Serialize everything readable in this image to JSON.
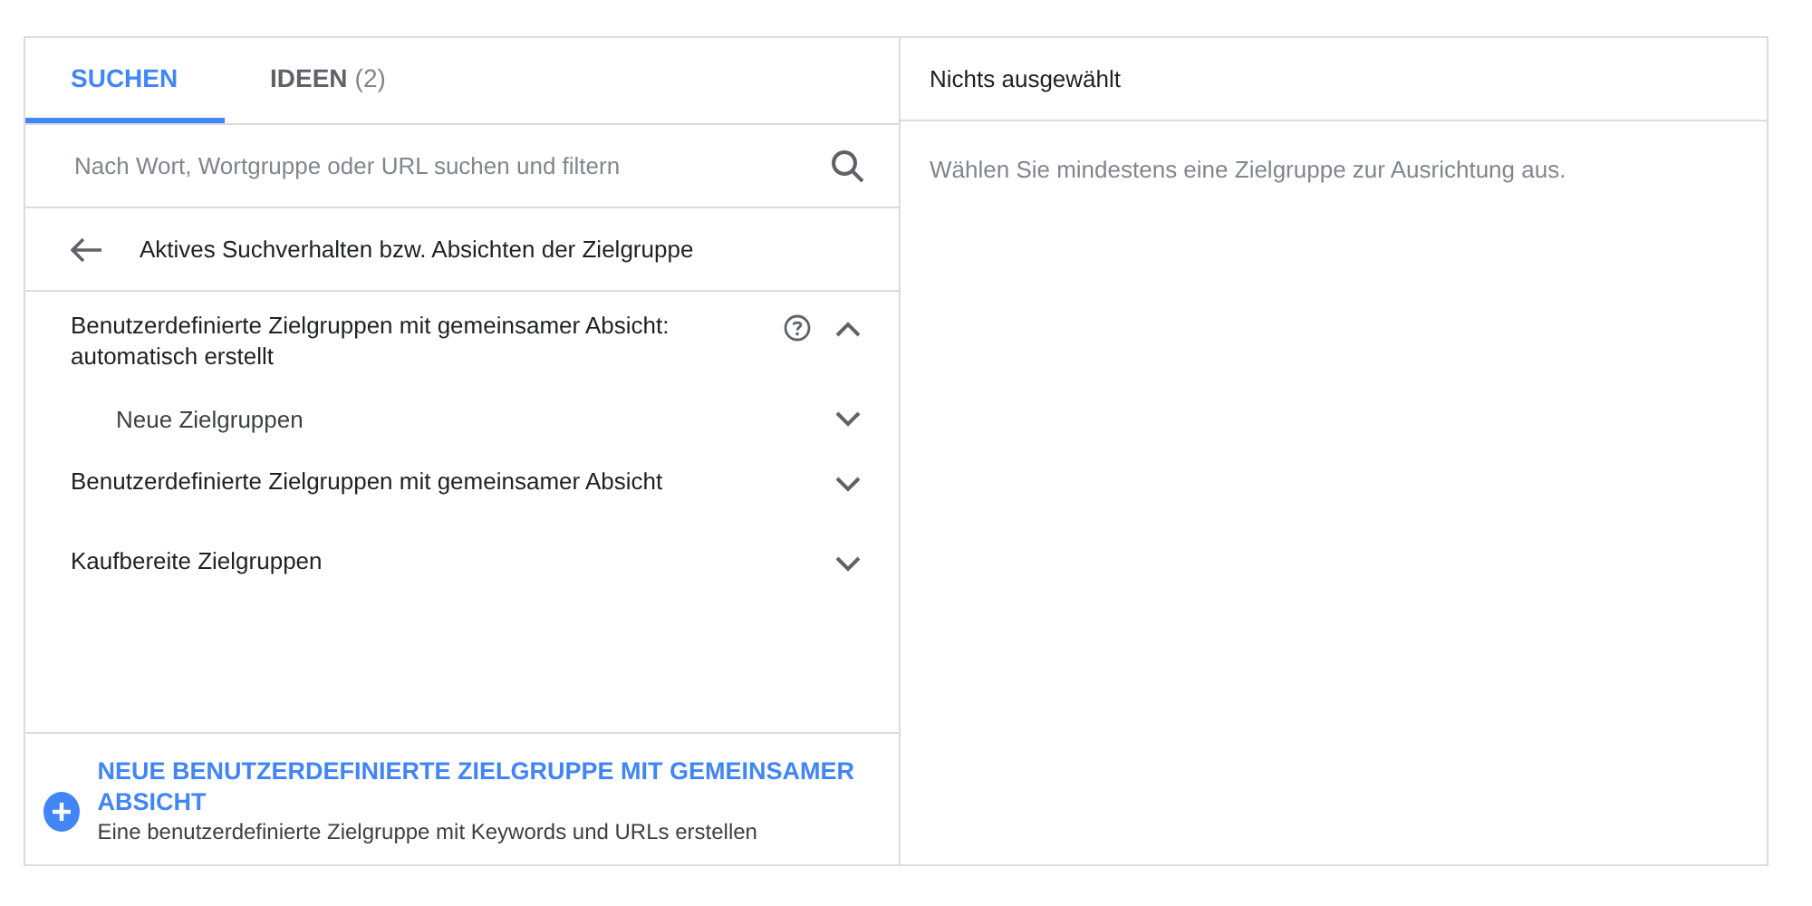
{
  "tabs": [
    {
      "label": "SUCHEN",
      "selected": true
    },
    {
      "label": "IDEEN",
      "count": "(2)",
      "selected": false
    }
  ],
  "search": {
    "placeholder": "Nach Wort, Wortgruppe oder URL suchen und filtern"
  },
  "breadcrumb": {
    "title": "Aktives Suchverhalten bzw. Absichten der Zielgruppe"
  },
  "categories": [
    {
      "label": "Benutzerdefinierte Zielgruppen mit gemeinsamer Absicht: automatisch erstellt",
      "help": true,
      "expanded": true,
      "children": [
        {
          "label": "Neue Zielgruppen",
          "expanded": false
        }
      ]
    },
    {
      "label": "Benutzerdefinierte Zielgruppen mit gemeinsamer Absicht",
      "help": false,
      "expanded": false
    },
    {
      "label": "Kaufbereite Zielgruppen",
      "help": false,
      "expanded": false
    }
  ],
  "create": {
    "title": "NEUE BENUTZERDEFINIERTE ZIELGRUPPE MIT GEMEINSAMER ABSICHT",
    "subtitle": "Eine benutzerdefinierte Zielgruppe mit Keywords und URLs erstellen"
  },
  "selection": {
    "title": "Nichts ausgewählt",
    "message": "Wählen Sie mindestens eine Zielgruppe zur Ausrichtung aus."
  }
}
